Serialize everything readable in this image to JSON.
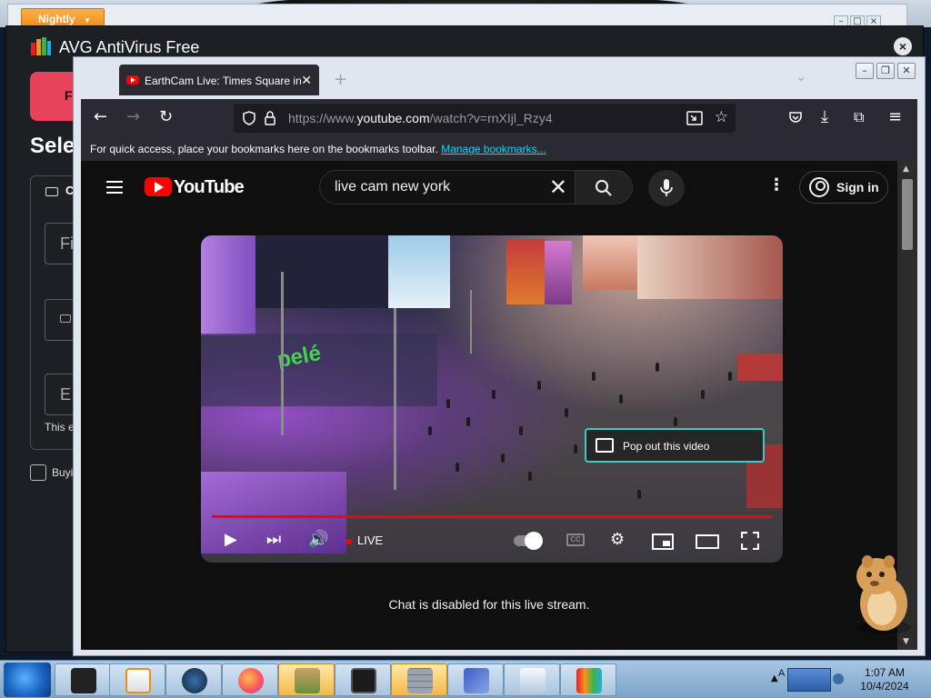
{
  "nightly": {
    "label": "Nightly"
  },
  "avg": {
    "title": "AVG AntiVirus Free",
    "red_button_text": "F",
    "heading": "Sele",
    "panel_label": "C",
    "field_first": "Fi",
    "field_third": "E",
    "note": "This e",
    "checkbox_label": "Buyi"
  },
  "browser": {
    "tab_title": "EarthCam Live: Times Square in",
    "new_tab": "+",
    "url_prefix": "https://www.",
    "url_domain": "youtube.com",
    "url_path": "/watch?v=rnXIjl_Rzy4",
    "bookmarks_text": "For quick access, place your bookmarks here on the bookmarks toolbar.",
    "bookmarks_link": "Manage bookmarks..."
  },
  "youtube": {
    "logo_text": "YouTube",
    "search_value": "live cam new york",
    "sign_in": "Sign in",
    "video": {
      "live_label": "LIVE",
      "popout_label": "Pop out this video",
      "billboard_text": "pelé",
      "cc_label": "CC"
    },
    "chat_disabled": "Chat is disabled for this live stream."
  },
  "taskbar": {
    "time": "1:07 AM",
    "date": "10/4/2024",
    "tray_letter": "A",
    "items": [
      "app-dark",
      "media-player",
      "globe",
      "firefox",
      "game-box",
      "monitor",
      "wall",
      "flag",
      "document",
      "multicolor-app"
    ]
  }
}
